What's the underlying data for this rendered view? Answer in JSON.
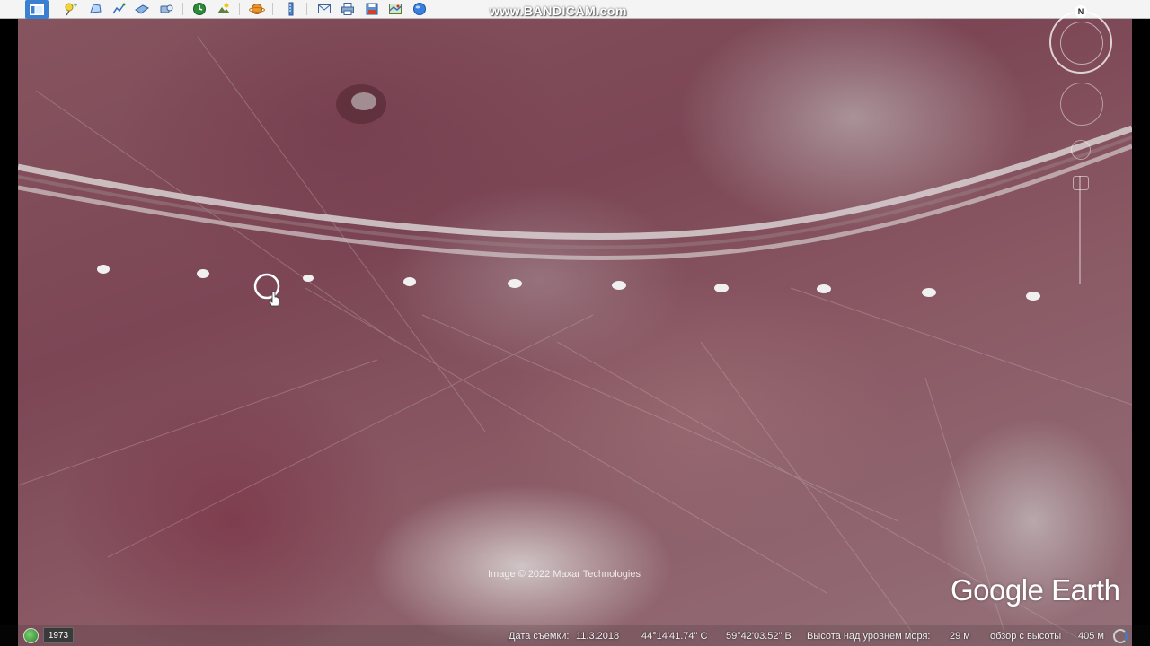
{
  "app": {
    "watermark": "www.BANDICAM.com"
  },
  "toolbar": {
    "buttons": [
      {
        "name": "sidebar-toggle",
        "icon": "sidebar-icon"
      },
      {
        "name": "add-placemark-button",
        "icon": "pushpin-icon"
      },
      {
        "name": "add-polygon-button",
        "icon": "polygon-icon"
      },
      {
        "name": "add-path-button",
        "icon": "path-icon"
      },
      {
        "name": "add-image-overlay-button",
        "icon": "image-overlay-icon"
      },
      {
        "name": "record-tour-button",
        "icon": "record-tour-icon"
      },
      {
        "name": "historical-imagery-button",
        "icon": "clock-icon"
      },
      {
        "name": "sunlight-button",
        "icon": "sunlight-icon"
      },
      {
        "name": "planet-switch-button",
        "icon": "planet-icon"
      },
      {
        "name": "ruler-button",
        "icon": "ruler-icon"
      },
      {
        "name": "email-button",
        "icon": "email-icon"
      },
      {
        "name": "print-button",
        "icon": "print-icon"
      },
      {
        "name": "save-image-button",
        "icon": "save-image-icon"
      },
      {
        "name": "view-in-maps-button",
        "icon": "maps-icon"
      },
      {
        "name": "sky-button",
        "icon": "sky-icon"
      }
    ]
  },
  "map": {
    "imagery_credit": "Image © 2022 Maxar Technologies",
    "logo": "Google Earth",
    "compass_label": "N"
  },
  "status_bar": {
    "historical_year": "1973",
    "imagery_date_label": "Дата съемки:",
    "imagery_date": "11.3.2018",
    "latitude": "44°14'41.74\" С",
    "longitude": "59°42'03.52\" В",
    "elevation_label": "Высота над уровнем моря:",
    "elevation_value": "29 м",
    "eye_alt_label": "обзор с высоты",
    "eye_alt_value": "405 м"
  },
  "colors": {
    "terrain": "#7e4a55",
    "toolbar_bg": "#f4f4f4",
    "accent": "#3a7fd0"
  }
}
